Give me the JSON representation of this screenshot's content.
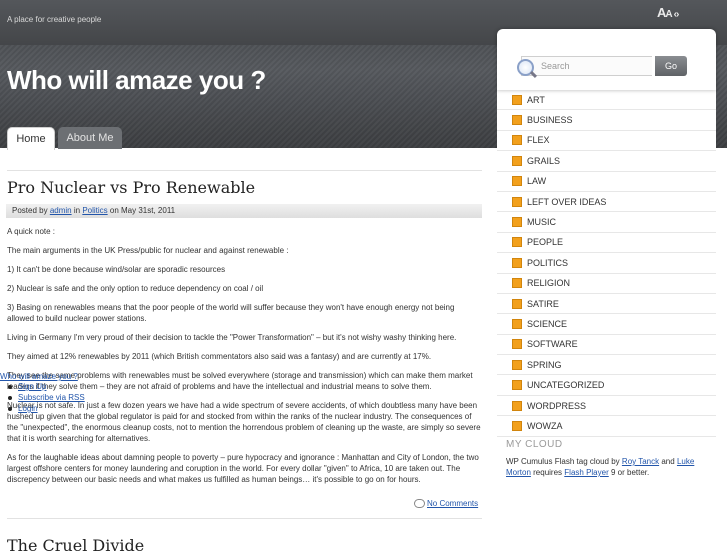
{
  "header": {
    "tagline": "A place for creative people",
    "font_size_control": {
      "big": "A",
      "small": "A",
      "arrows": "‹›"
    },
    "site_title": "Who will amaze you ?"
  },
  "nav": {
    "tabs": [
      {
        "label": "Home"
      },
      {
        "label": "About Me"
      }
    ]
  },
  "post": {
    "title": "Pro Nuclear vs Pro Renewable",
    "meta": {
      "posted_by": "Posted by",
      "author": "admin",
      "in_word": "in",
      "category": "Politics",
      "date": "on May 31st, 2011"
    },
    "paragraphs": [
      "A quick note :",
      "The main arguments in the UK Press/public for nuclear and against renewable :",
      "1) It can't be done because wind/solar are sporadic resources",
      "2) Nuclear is safe and the only option to reduce dependency on coal / oil",
      "3) Basing on renewables means that the poor people of the world will suffer because they won't have enough energy not being allowed to build nuclear power stations.",
      "Living in Germany I'm very proud of their decision to tackle the \"Power Transformation\" – but it's not wishy washy thinking here.",
      "They aimed at 12% renewables by 2011 (which British commentators also said was a fantasy) and are currently at 17%.",
      "They see the same problems with renewables must be solved everywhere (storage and transmission) which can make them market leaders if they solve them – they are not afraid of problems and have the intellectual and industrial means to solve them.",
      "Nuclear is not safe.  In just a few dozen years we have had a wide spectrum of severe accidents, of which doubtless many have been hushed up given that the global regulator is paid for and stocked from within the ranks of the nuclear industry.  The consequences of the \"unexpected\", the enormous cleanup costs, not to mention the horrendous problem of cleaning up the waste, are simply so severe that it is worth searching for alternatives.",
      "As for the laughable ideas about damning people to poverty – pure hypocracy and ignorance :  Manhattan and City of London, the two largest offshore centers for money laundering and coruption in the world. For every dollar \"given\" to Africa, 10 are taken out. The discrepency between our basic needs and what makes us fulfilled as human beings… it's possible to go on for hours."
    ],
    "comments_link": "No Comments"
  },
  "next_post": {
    "title": "The Cruel Divide"
  },
  "meta_widget": {
    "heading": "Who will amaze you ?",
    "items": [
      "Sign Up",
      "Subscribe via RSS",
      "Login"
    ]
  },
  "sidebar": {
    "search": {
      "placeholder": "Search",
      "button_label": "Go"
    },
    "categories": [
      "ART",
      "BUSINESS",
      "FLEX",
      "GRAILS",
      "LAW",
      "LEFT OVER IDEAS",
      "MUSIC",
      "PEOPLE",
      "POLITICS",
      "RELIGION",
      "SATIRE",
      "SCIENCE",
      "SOFTWARE",
      "SPRING",
      "UNCATEGORIZED",
      "WORDPRESS",
      "WOWZA"
    ],
    "cloud": {
      "heading": "MY CLOUD",
      "text_1": "WP Cumulus Flash tag cloud by",
      "link_1": "Roy Tanck",
      "text_2": "and",
      "link_2": "Luke Morton",
      "text_3": "requires",
      "link_3": "Flash Player",
      "text_4": "9 or better."
    }
  },
  "colors": {
    "accent_orange": "#f2a01c",
    "link_blue": "#2255aa",
    "header_dark": "#3b3d40"
  }
}
